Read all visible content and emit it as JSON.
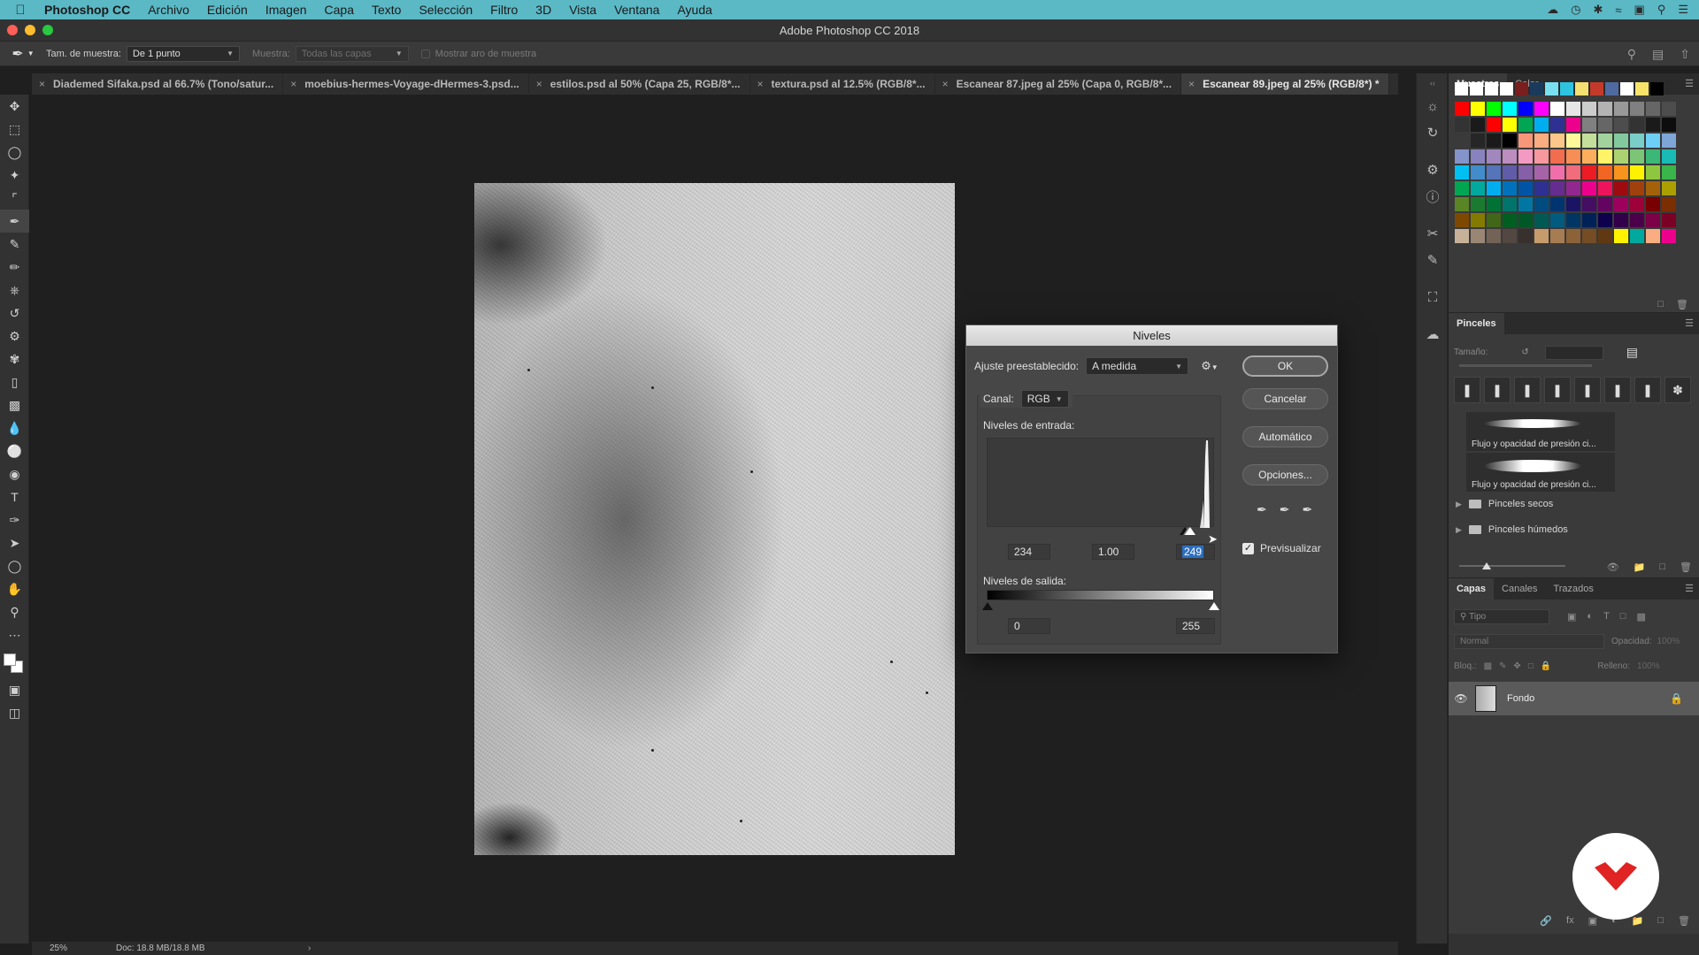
{
  "menubar": {
    "items": [
      "Photoshop CC",
      "Archivo",
      "Edición",
      "Imagen",
      "Capa",
      "Texto",
      "Selección",
      "Filtro",
      "3D",
      "Vista",
      "Ventana",
      "Ayuda"
    ]
  },
  "window": {
    "title": "Adobe Photoshop CC 2018"
  },
  "options_bar": {
    "sample_size_label": "Tam. de muestra:",
    "sample_size_value": "De 1 punto",
    "sample_label": "Muestra:",
    "sample_value": "Todas las capas",
    "show_ring_label": "Mostrar aro de muestra"
  },
  "tabs": [
    {
      "label": "Diademed Sifaka.psd al 66.7% (Tono/satur...",
      "active": false
    },
    {
      "label": "moebius-hermes-Voyage-dHermes-3.psd...",
      "active": false
    },
    {
      "label": "estilos.psd al 50% (Capa 25, RGB/8*...",
      "active": false
    },
    {
      "label": "textura.psd al 12.5% (RGB/8*...",
      "active": false
    },
    {
      "label": "Escanear 87.jpeg al 25% (Capa 0, RGB/8*...",
      "active": false
    },
    {
      "label": "Escanear 89.jpeg al 25% (RGB/8*) *",
      "active": true
    }
  ],
  "status_bar": {
    "zoom": "25%",
    "doc": "Doc: 18.8 MB/18.8 MB"
  },
  "levels_dialog": {
    "title": "Niveles",
    "preset_label": "Ajuste preestablecido:",
    "preset_value": "A medida",
    "channel_label": "Canal:",
    "channel_value": "RGB",
    "input_label": "Niveles de entrada:",
    "input_black": "234",
    "input_gamma": "1.00",
    "input_white": "249",
    "output_label": "Niveles de salida:",
    "output_black": "0",
    "output_white": "255",
    "buttons": {
      "ok": "OK",
      "cancel": "Cancelar",
      "auto": "Automático",
      "options": "Opciones..."
    },
    "preview_label": "Previsualizar",
    "preview_checked": true
  },
  "swatches_panel": {
    "tabs": [
      "Muestras",
      "Color"
    ],
    "recent": [
      "#ffffff",
      "#ffffff",
      "#ffffff",
      "#ffffff",
      "#7a1e1e",
      "#1a3a5c",
      "#79e0f0",
      "#2ec4e0",
      "#f3e070",
      "#c43a2a",
      "#4f6aa0",
      "#ffffff",
      "#f7e36a",
      "#000000"
    ],
    "grid": [
      "#ff0000",
      "#ffff00",
      "#00ff00",
      "#00ffff",
      "#0000ff",
      "#ff00ff",
      "#ffffff",
      "#e6e6e6",
      "#cccccc",
      "#b3b3b3",
      "#999999",
      "#808080",
      "#666666",
      "#4d4d4d",
      "#333333",
      "#1a1a1a",
      "#ff0000",
      "#ffff00",
      "#00a651",
      "#00aeef",
      "#2e3192",
      "#ec008c",
      "#808080",
      "#666666",
      "#4d4d4d",
      "#333333",
      "#1a1a1a",
      "#0d0d0d",
      "#3a3a3a",
      "#262626",
      "#1a1a1a",
      "#000000",
      "#f7977a",
      "#f9ad81",
      "#fdc68a",
      "#fff79a",
      "#c4df9b",
      "#a3d39c",
      "#82ca9d",
      "#7bcdc8",
      "#6ecff6",
      "#7ea7d8",
      "#8493ca",
      "#8882be",
      "#a187be",
      "#bc8dbf",
      "#f49ac2",
      "#f6989d",
      "#f26c4f",
      "#f68e55",
      "#fbaf5c",
      "#fff467",
      "#acd372",
      "#7cc576",
      "#3bb878",
      "#1abbb4",
      "#00bff3",
      "#438ccb",
      "#5574b9",
      "#605ca8",
      "#855fa8",
      "#a763a8",
      "#f06eaa",
      "#f16d7e",
      "#ed1c24",
      "#f26522",
      "#f7941d",
      "#fff200",
      "#8dc73f",
      "#39b54a",
      "#00a651",
      "#00a99d",
      "#00aeef",
      "#0072bc",
      "#0054a6",
      "#2e3192",
      "#662d91",
      "#92278f",
      "#ec008c",
      "#ed145b",
      "#9e0b0f",
      "#a0410d",
      "#a36209",
      "#aba000",
      "#598527",
      "#1a7b30",
      "#007236",
      "#00746b",
      "#0076a3",
      "#004b80",
      "#003471",
      "#1b1464",
      "#440e62",
      "#630460",
      "#9e005d",
      "#9e0039",
      "#790000",
      "#7b2e00",
      "#7d4900",
      "#827b00",
      "#406618",
      "#005e20",
      "#005826",
      "#005952",
      "#005b7f",
      "#003663",
      "#002157",
      "#0d004c",
      "#32004b",
      "#4b0049",
      "#7b0046",
      "#7a0026",
      "#c7b299",
      "#998675",
      "#736357",
      "#534741",
      "#37302d",
      "#c69c6d",
      "#a67c52",
      "#8c6239",
      "#754c24",
      "#603913",
      "#fff200",
      "#00a99d",
      "#f9ad81",
      "#ec008c"
    ]
  },
  "brushes_panel": {
    "title": "Pinceles",
    "size_label": "Tamaño:",
    "presets": [
      {
        "name": "Flujo y opacidad de presión ci..."
      },
      {
        "name": "Flujo y opacidad de presión ci..."
      }
    ],
    "groups": [
      "Pinceles secos",
      "Pinceles húmedos"
    ]
  },
  "layers_panel": {
    "tabs": [
      "Capas",
      "Canales",
      "Trazados"
    ],
    "kind_placeholder": "Tipo",
    "blend_mode": "Normal",
    "opacity_label": "Opacidad:",
    "opacity_value": "100%",
    "lock_label": "Bloq.:",
    "fill_label": "Relleno:",
    "fill_value": "100%",
    "layers": [
      {
        "name": "Fondo",
        "visible": true,
        "locked": true
      }
    ]
  },
  "colors": {
    "menubar_bg": "#5bb8c5",
    "app_bg": "#1f1f1f",
    "panel_bg": "#3a3a3a",
    "selection_blue": "#2d6fbf",
    "brand_red": "#e02323"
  }
}
